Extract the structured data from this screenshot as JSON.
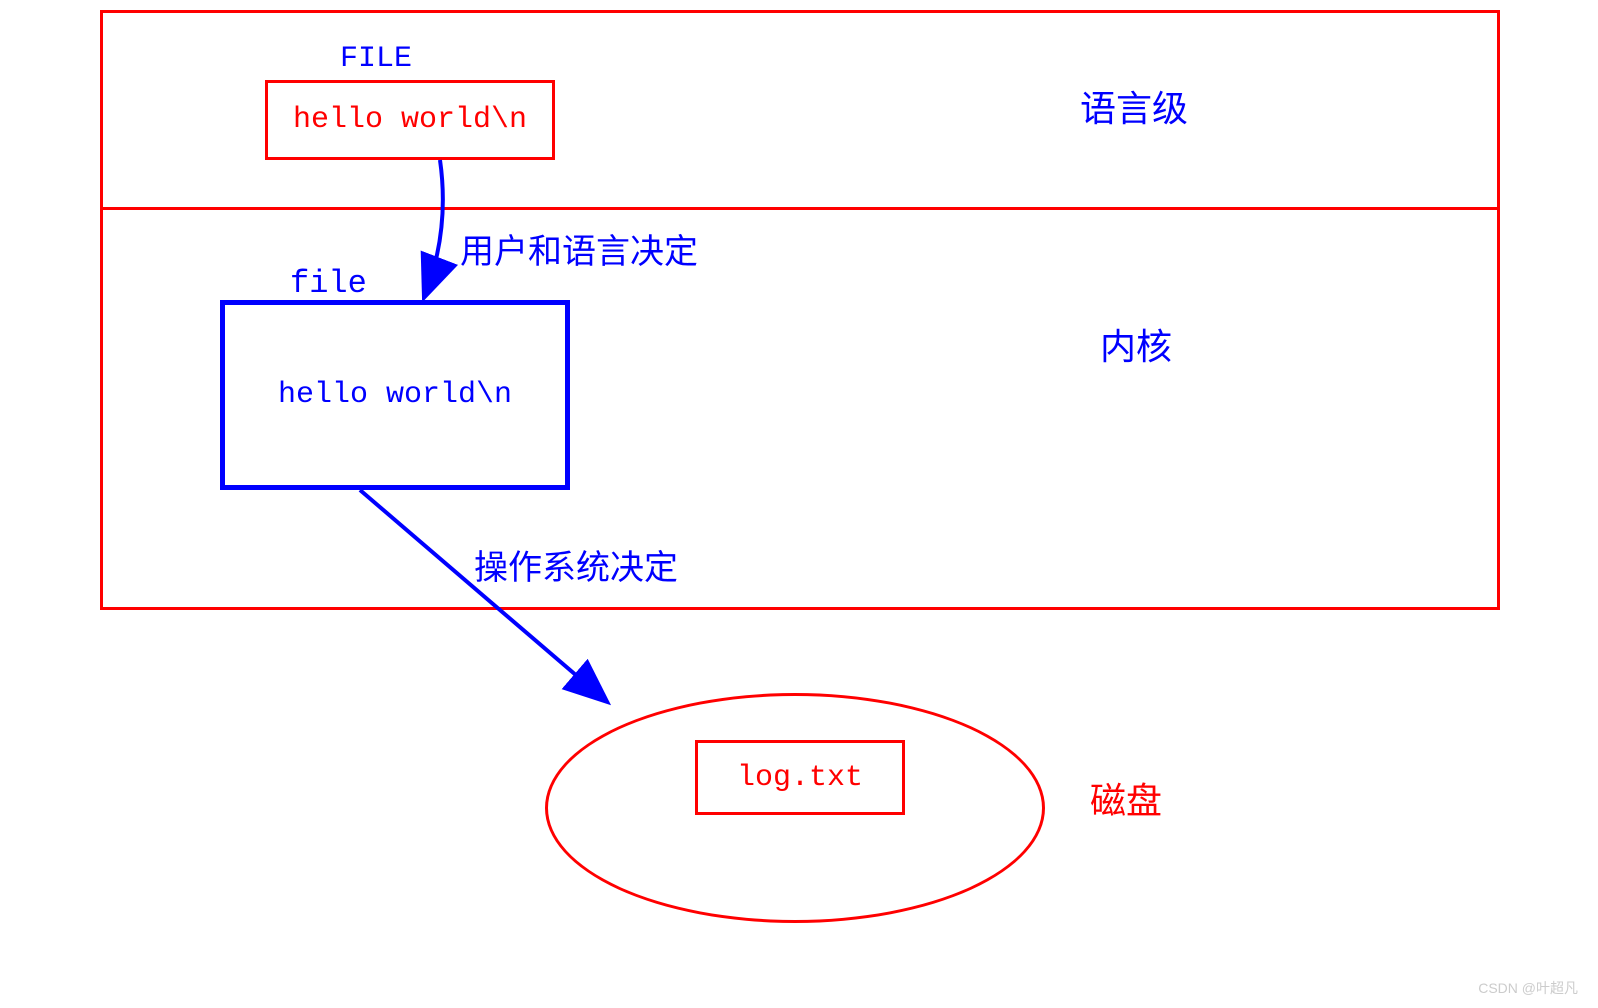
{
  "diagram": {
    "top_layer": {
      "file_label": "FILE",
      "content": "hello world\\n",
      "level_label": "语言级"
    },
    "middle_layer": {
      "file_label": "file",
      "content": "hello world\\n",
      "level_label": "内核"
    },
    "arrow_labels": {
      "top_to_middle": "用户和语言决定",
      "middle_to_disk": "操作系统决定"
    },
    "disk": {
      "filename": "log.txt",
      "label": "磁盘"
    },
    "watermark": "CSDN @叶超凡"
  }
}
